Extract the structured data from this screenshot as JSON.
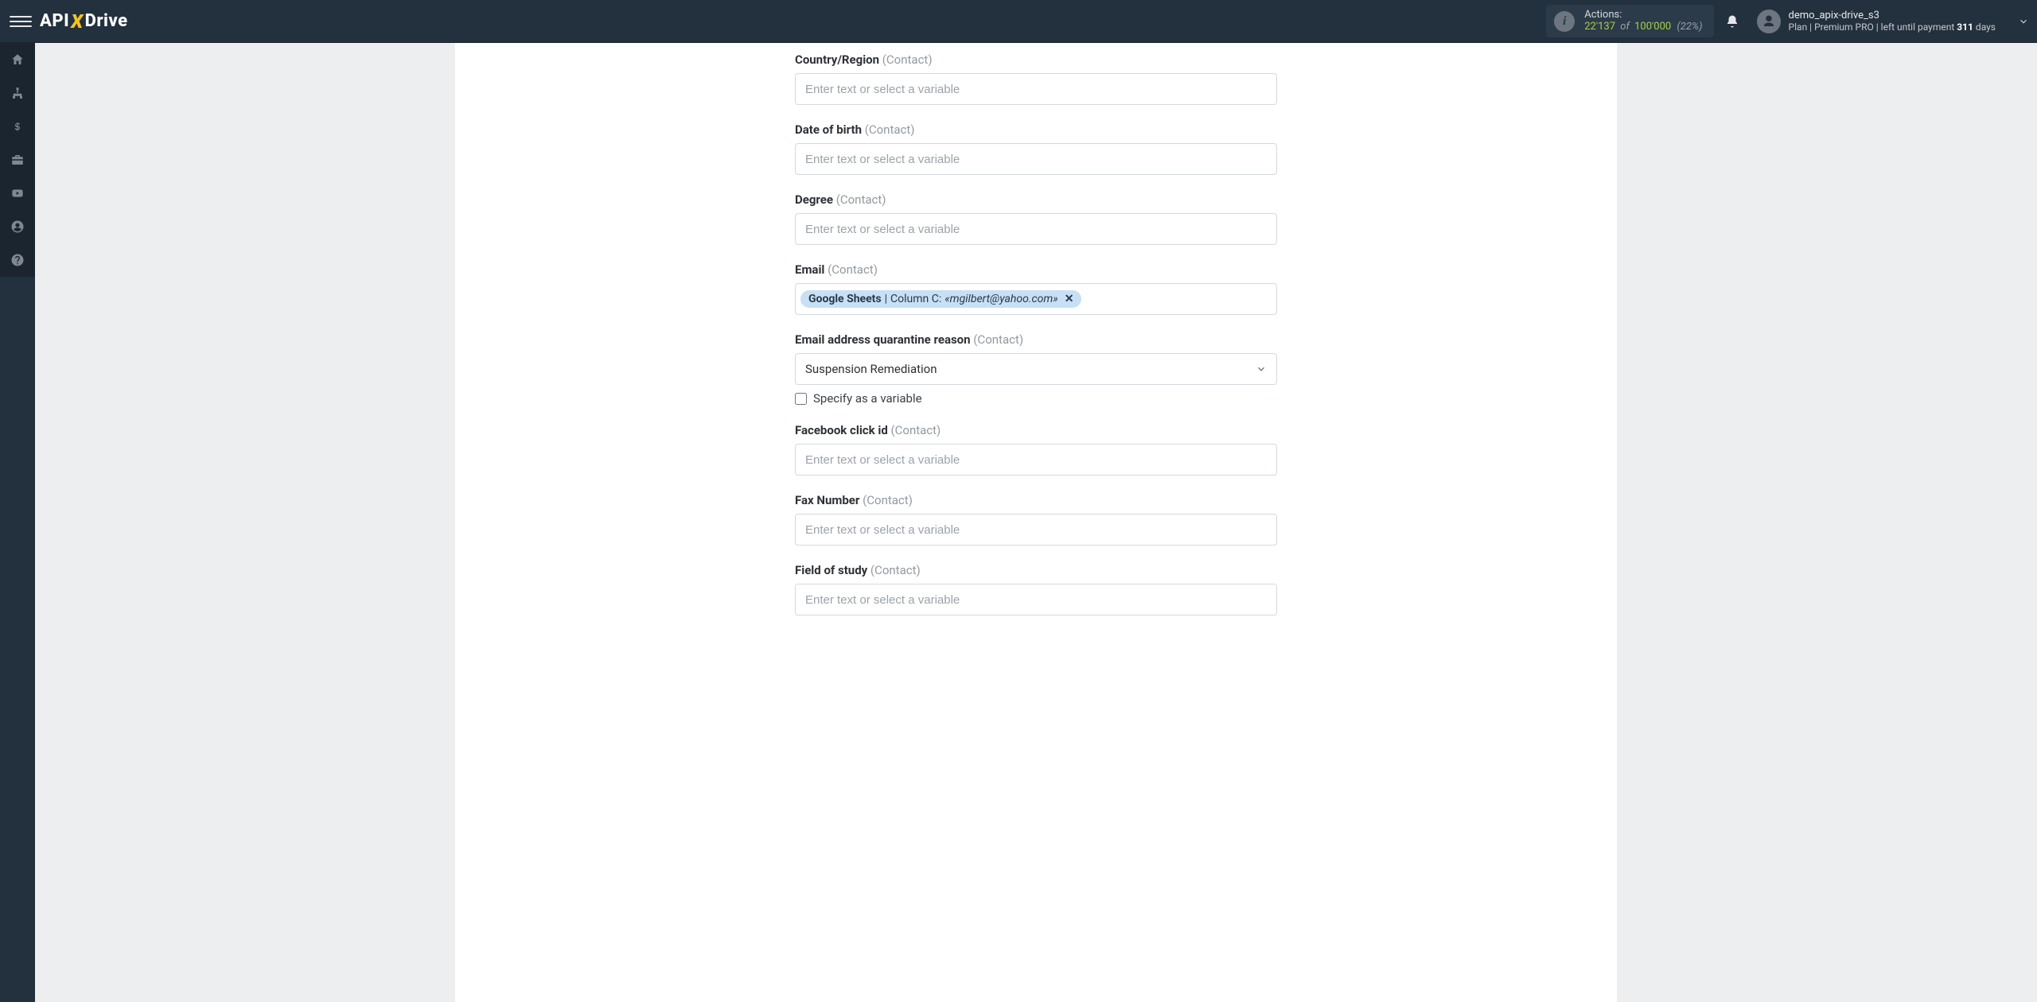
{
  "header": {
    "logo": {
      "part1": "API",
      "part2": "X",
      "part3": "Drive"
    },
    "actions": {
      "label": "Actions:",
      "used": "22'137",
      "of": "of",
      "total": "100'000",
      "pct": "(22%)"
    },
    "user": {
      "name": "demo_apix-drive_s3",
      "plan_prefix": "Plan |",
      "plan_name": "Premium PRO",
      "plan_mid": "| left until payment",
      "days": "311",
      "days_suffix": "days"
    }
  },
  "form": {
    "placeholder": "Enter text or select a variable",
    "suffix": "(Contact)",
    "checkbox_label": "Specify as a variable",
    "fields": {
      "country": {
        "label": "Country/Region"
      },
      "dob": {
        "label": "Date of birth"
      },
      "degree": {
        "label": "Degree"
      },
      "email": {
        "label": "Email",
        "token_source": "Google Sheets",
        "token_sep": " | ",
        "token_col_prefix": "Column C: ",
        "token_value": "«mgilbert@yahoo.com»"
      },
      "quarantine": {
        "label": "Email address quarantine reason",
        "selected": "Suspension Remediation"
      },
      "fbclick": {
        "label": "Facebook click id"
      },
      "fax": {
        "label": "Fax Number"
      },
      "study": {
        "label": "Field of study"
      }
    }
  }
}
